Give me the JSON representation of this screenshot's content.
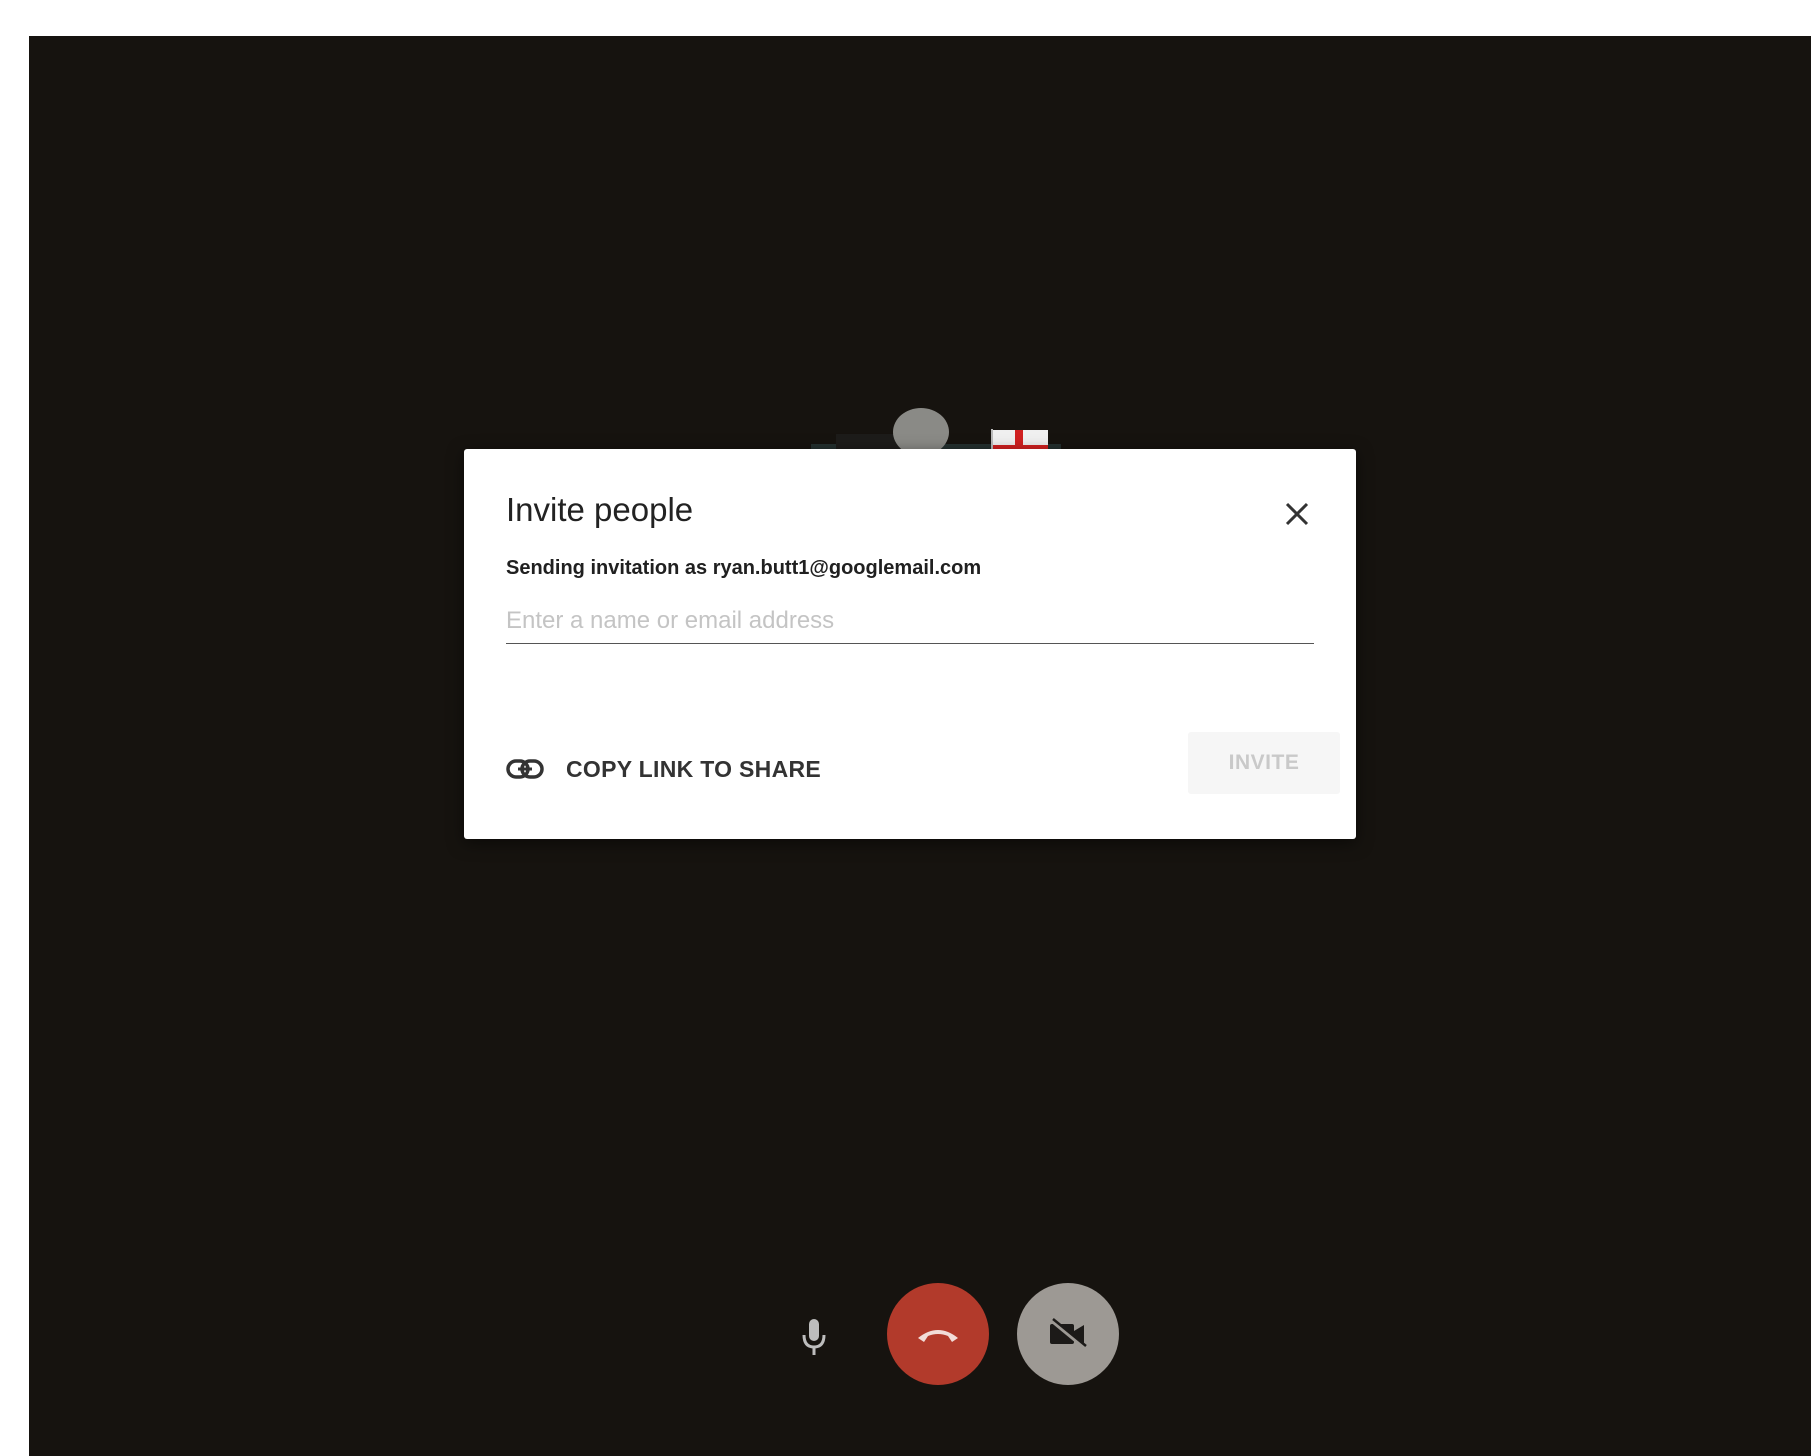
{
  "dialog": {
    "title": "Invite people",
    "subtitle": "Sending invitation as ryan.butt1@googlemail.com",
    "input": {
      "value": "",
      "placeholder": "Enter a name or email address"
    },
    "copy_link_label": "COPY LINK TO SHARE",
    "invite_label": "INVITE",
    "invite_enabled": false
  },
  "call_controls": {
    "microphone": {
      "icon": "microphone-icon",
      "muted": false
    },
    "hangup": {
      "icon": "hangup-icon",
      "color": "#b23a2b"
    },
    "camera": {
      "icon": "camera-off-icon",
      "color": "#9d9994",
      "enabled": false
    }
  },
  "colors": {
    "background": "#16130f",
    "dialog": "#ffffff",
    "hangup": "#b23a2b",
    "camera": "#9d9994"
  }
}
